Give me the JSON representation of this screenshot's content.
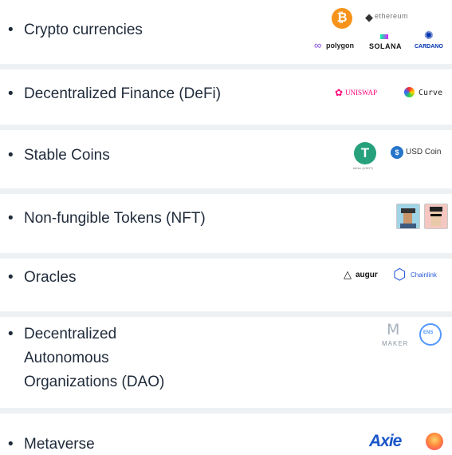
{
  "rows": [
    {
      "label": "Crypto currencies",
      "logos": {
        "bitcoin": "bitcoin-icon",
        "ethereum": "ethereum",
        "polygon": "polygon",
        "solana": "SOLANA",
        "cardano": "CARDANO"
      }
    },
    {
      "label": "Decentralized Finance (DeFi)",
      "logos": {
        "uniswap": "UNISWAP",
        "curve": "Curve"
      }
    },
    {
      "label": "Stable Coins",
      "logos": {
        "tether_caption": "tether (USDT)",
        "usdcoin": "USD Coin"
      }
    },
    {
      "label": "Non-fungible Tokens (NFT)",
      "logos": {
        "punk1": "cryptopunk-icon",
        "punk2": "cryptopunk-icon"
      }
    },
    {
      "label": "Oracles",
      "logos": {
        "augur": "augur",
        "chainlink": "Chainlink"
      }
    },
    {
      "label_lines": [
        "Decentralized",
        "Autonomous",
        "Organizations (DAO)"
      ],
      "logos": {
        "maker": "MAKER",
        "ens": "ENS"
      }
    },
    {
      "label": "Metaverse",
      "logos": {
        "axie": "Axie",
        "decentraland": "decentraland-icon"
      }
    }
  ],
  "bullet": "•",
  "colors": {
    "text": "#1f2a3a",
    "divider": "#eef1f4",
    "bitcoin": "#f7931a",
    "polygon": "#8247e5",
    "uniswap": "#ff007a",
    "tether": "#26a17b",
    "usdcoin": "#2775ca",
    "chainlink": "#2a5ada",
    "axie": "#1a56c9"
  }
}
